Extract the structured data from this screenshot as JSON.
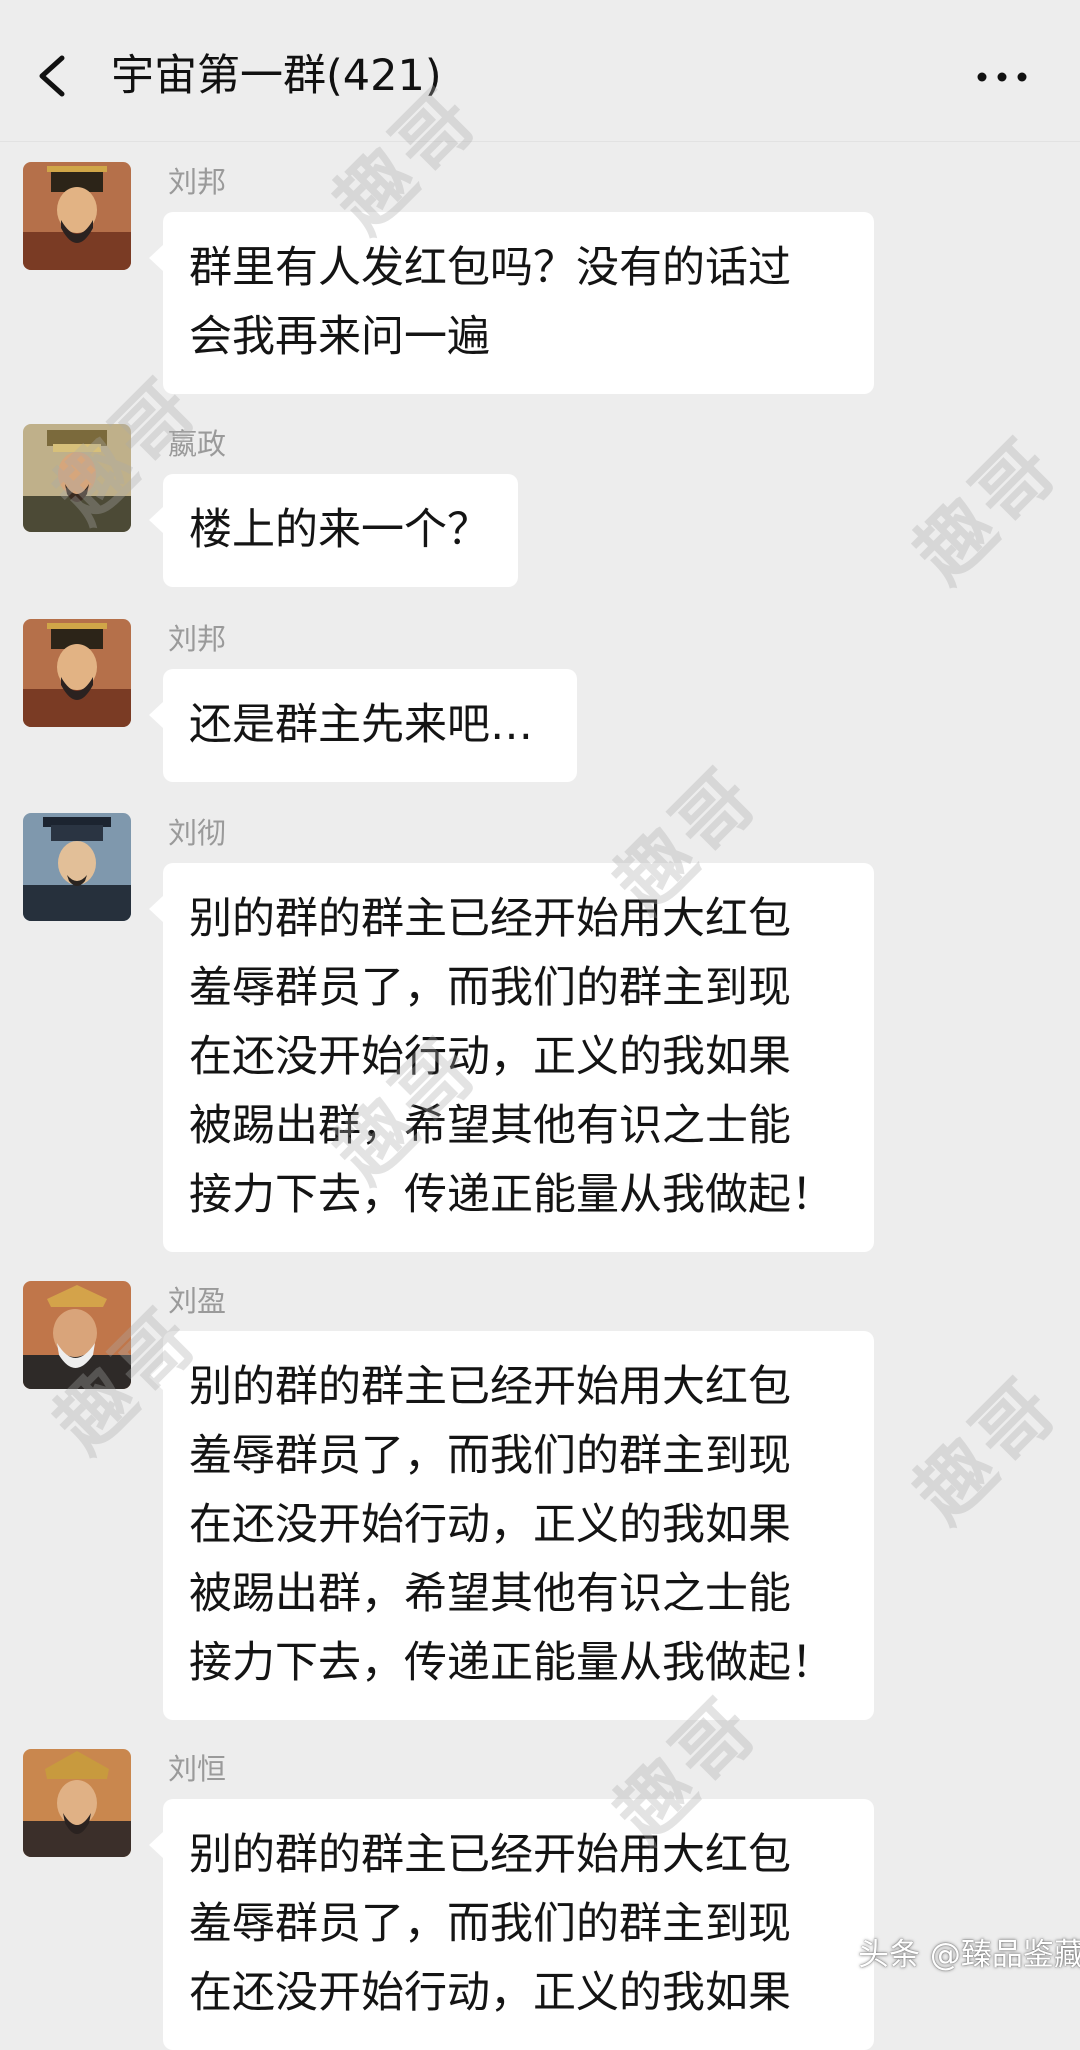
{
  "header": {
    "title": "宇宙第一群(421)",
    "back_icon": "chevron-left-icon",
    "more_icon": "more-dots-icon"
  },
  "messages": [
    {
      "sender": "刘邦",
      "lines": [
        "群里有人发红包吗？没有的话过",
        "会我再来问一遍"
      ]
    },
    {
      "sender": "嬴政",
      "lines": [
        "楼上的来一个？"
      ]
    },
    {
      "sender": "刘邦",
      "lines": [
        "还是群主先来吧…"
      ]
    },
    {
      "sender": "刘彻",
      "lines": [
        "别的群的群主已经开始用大红包",
        "羞辱群员了，而我们的群主到现",
        "在还没开始行动，正义的我如果",
        "被踢出群，希望其他有识之士能",
        "接力下去，传递正能量从我做起！"
      ]
    },
    {
      "sender": "刘盈",
      "lines": [
        "别的群的群主已经开始用大红包",
        "羞辱群员了，而我们的群主到现",
        "在还没开始行动，正义的我如果",
        "被踢出群，希望其他有识之士能",
        "接力下去，传递正能量从我做起！"
      ]
    },
    {
      "sender": "刘恒",
      "lines": [
        "别的群的群主已经开始用大红包",
        "羞辱群员了，而我们的群主到现",
        "在还没开始行动，正义的我如果"
      ]
    }
  ],
  "watermark": {
    "text": "趣哥"
  },
  "corner_watermark": "头条 @臻品鉴藏",
  "colors": {
    "background": "#ededed",
    "bubble": "#ffffff",
    "sender_name": "#9a9a9a"
  }
}
